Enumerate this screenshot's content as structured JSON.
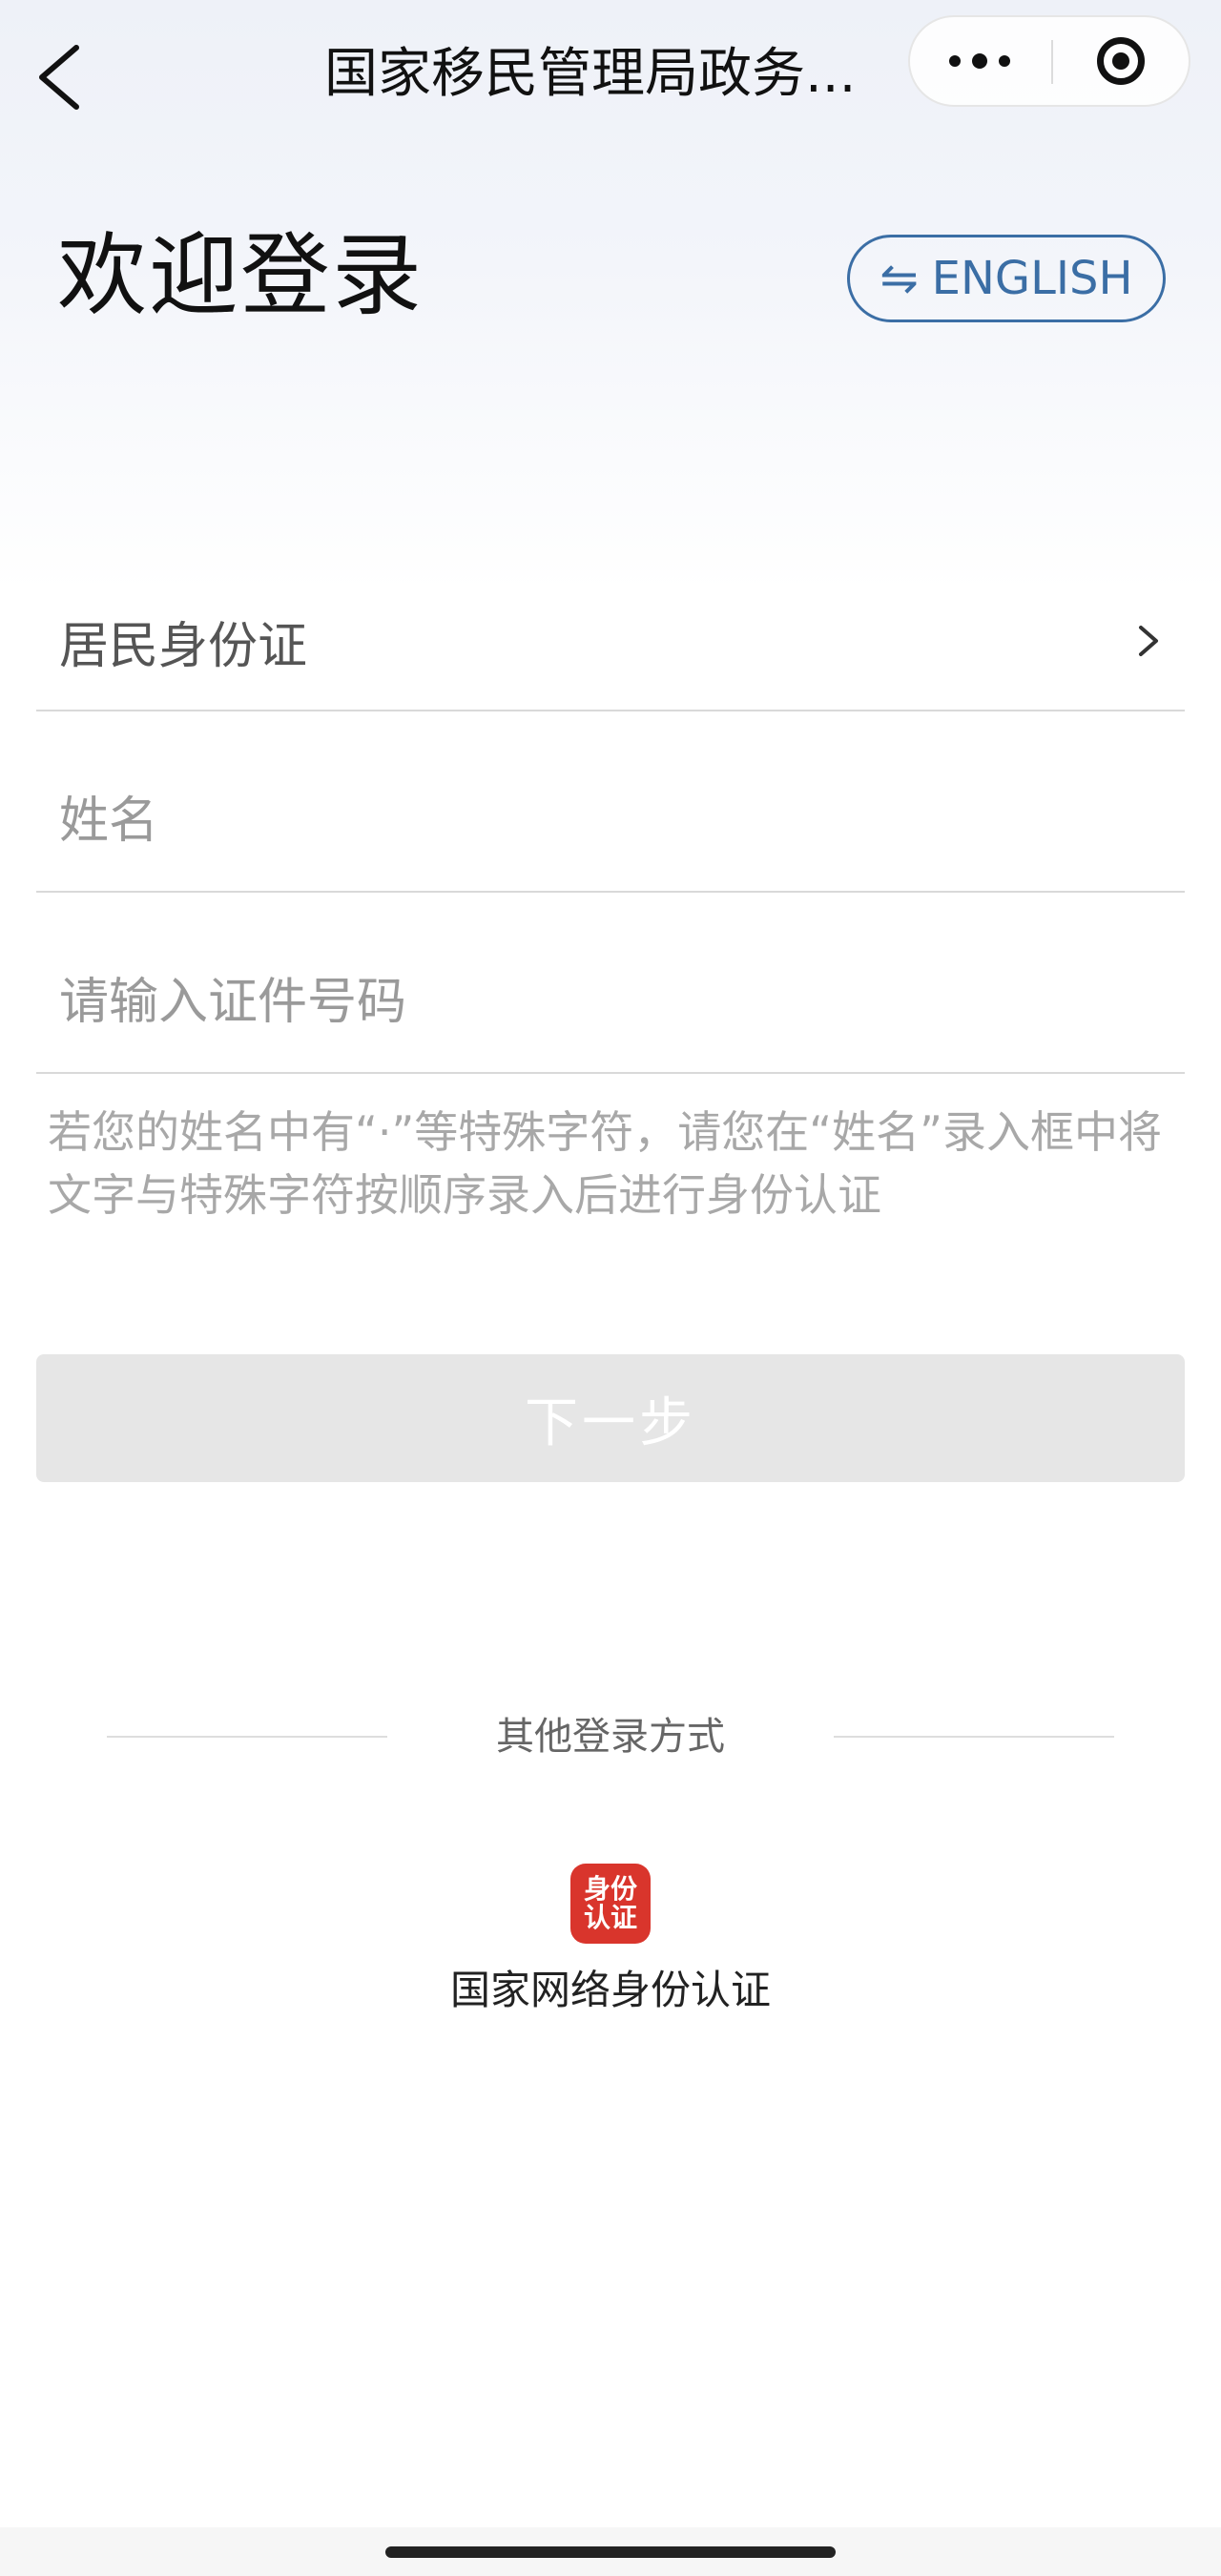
{
  "nav": {
    "title": "国家移民管理局政务...",
    "back_icon": "chevron-left-icon",
    "more_icon": "more-dots-icon",
    "close_icon": "target-circle-icon"
  },
  "header": {
    "welcome": "欢迎登录",
    "language_button": "ENGLISH",
    "language_icon": "switch-arrows-icon",
    "accent_color": "#3b6ea5"
  },
  "form": {
    "id_type": "居民身份证",
    "name_placeholder": "姓名",
    "id_number_placeholder": "请输入证件号码",
    "hint": "若您的姓名中有“·”等特殊字符，请您在“姓名”录入框中将文字与特殊字符按顺序录入后进行身份认证",
    "next_button": "下一步"
  },
  "other_login": {
    "title": "其他登录方式",
    "method_label": "国家网络身份认证",
    "logo_text_top": "身份",
    "logo_text_bottom": "认证",
    "logo_color": "#d9352c"
  }
}
